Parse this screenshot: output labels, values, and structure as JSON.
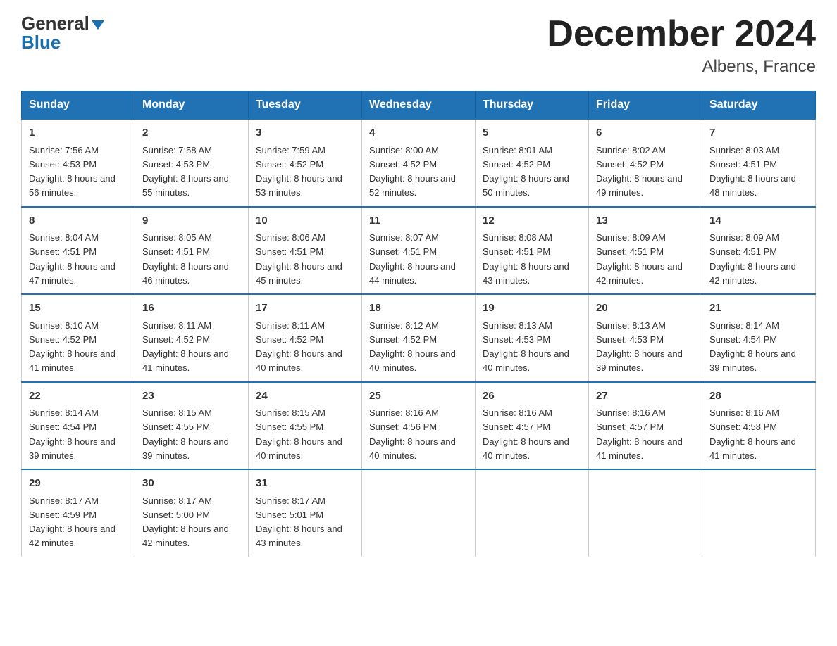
{
  "header": {
    "logo_line1": "General",
    "logo_line2": "Blue",
    "title": "December 2024",
    "subtitle": "Albens, France"
  },
  "days_of_week": [
    "Sunday",
    "Monday",
    "Tuesday",
    "Wednesday",
    "Thursday",
    "Friday",
    "Saturday"
  ],
  "weeks": [
    [
      {
        "day": "1",
        "sunrise": "7:56 AM",
        "sunset": "4:53 PM",
        "daylight": "8 hours and 56 minutes."
      },
      {
        "day": "2",
        "sunrise": "7:58 AM",
        "sunset": "4:53 PM",
        "daylight": "8 hours and 55 minutes."
      },
      {
        "day": "3",
        "sunrise": "7:59 AM",
        "sunset": "4:52 PM",
        "daylight": "8 hours and 53 minutes."
      },
      {
        "day": "4",
        "sunrise": "8:00 AM",
        "sunset": "4:52 PM",
        "daylight": "8 hours and 52 minutes."
      },
      {
        "day": "5",
        "sunrise": "8:01 AM",
        "sunset": "4:52 PM",
        "daylight": "8 hours and 50 minutes."
      },
      {
        "day": "6",
        "sunrise": "8:02 AM",
        "sunset": "4:52 PM",
        "daylight": "8 hours and 49 minutes."
      },
      {
        "day": "7",
        "sunrise": "8:03 AM",
        "sunset": "4:51 PM",
        "daylight": "8 hours and 48 minutes."
      }
    ],
    [
      {
        "day": "8",
        "sunrise": "8:04 AM",
        "sunset": "4:51 PM",
        "daylight": "8 hours and 47 minutes."
      },
      {
        "day": "9",
        "sunrise": "8:05 AM",
        "sunset": "4:51 PM",
        "daylight": "8 hours and 46 minutes."
      },
      {
        "day": "10",
        "sunrise": "8:06 AM",
        "sunset": "4:51 PM",
        "daylight": "8 hours and 45 minutes."
      },
      {
        "day": "11",
        "sunrise": "8:07 AM",
        "sunset": "4:51 PM",
        "daylight": "8 hours and 44 minutes."
      },
      {
        "day": "12",
        "sunrise": "8:08 AM",
        "sunset": "4:51 PM",
        "daylight": "8 hours and 43 minutes."
      },
      {
        "day": "13",
        "sunrise": "8:09 AM",
        "sunset": "4:51 PM",
        "daylight": "8 hours and 42 minutes."
      },
      {
        "day": "14",
        "sunrise": "8:09 AM",
        "sunset": "4:51 PM",
        "daylight": "8 hours and 42 minutes."
      }
    ],
    [
      {
        "day": "15",
        "sunrise": "8:10 AM",
        "sunset": "4:52 PM",
        "daylight": "8 hours and 41 minutes."
      },
      {
        "day": "16",
        "sunrise": "8:11 AM",
        "sunset": "4:52 PM",
        "daylight": "8 hours and 41 minutes."
      },
      {
        "day": "17",
        "sunrise": "8:11 AM",
        "sunset": "4:52 PM",
        "daylight": "8 hours and 40 minutes."
      },
      {
        "day": "18",
        "sunrise": "8:12 AM",
        "sunset": "4:52 PM",
        "daylight": "8 hours and 40 minutes."
      },
      {
        "day": "19",
        "sunrise": "8:13 AM",
        "sunset": "4:53 PM",
        "daylight": "8 hours and 40 minutes."
      },
      {
        "day": "20",
        "sunrise": "8:13 AM",
        "sunset": "4:53 PM",
        "daylight": "8 hours and 39 minutes."
      },
      {
        "day": "21",
        "sunrise": "8:14 AM",
        "sunset": "4:54 PM",
        "daylight": "8 hours and 39 minutes."
      }
    ],
    [
      {
        "day": "22",
        "sunrise": "8:14 AM",
        "sunset": "4:54 PM",
        "daylight": "8 hours and 39 minutes."
      },
      {
        "day": "23",
        "sunrise": "8:15 AM",
        "sunset": "4:55 PM",
        "daylight": "8 hours and 39 minutes."
      },
      {
        "day": "24",
        "sunrise": "8:15 AM",
        "sunset": "4:55 PM",
        "daylight": "8 hours and 40 minutes."
      },
      {
        "day": "25",
        "sunrise": "8:16 AM",
        "sunset": "4:56 PM",
        "daylight": "8 hours and 40 minutes."
      },
      {
        "day": "26",
        "sunrise": "8:16 AM",
        "sunset": "4:57 PM",
        "daylight": "8 hours and 40 minutes."
      },
      {
        "day": "27",
        "sunrise": "8:16 AM",
        "sunset": "4:57 PM",
        "daylight": "8 hours and 41 minutes."
      },
      {
        "day": "28",
        "sunrise": "8:16 AM",
        "sunset": "4:58 PM",
        "daylight": "8 hours and 41 minutes."
      }
    ],
    [
      {
        "day": "29",
        "sunrise": "8:17 AM",
        "sunset": "4:59 PM",
        "daylight": "8 hours and 42 minutes."
      },
      {
        "day": "30",
        "sunrise": "8:17 AM",
        "sunset": "5:00 PM",
        "daylight": "8 hours and 42 minutes."
      },
      {
        "day": "31",
        "sunrise": "8:17 AM",
        "sunset": "5:01 PM",
        "daylight": "8 hours and 43 minutes."
      },
      null,
      null,
      null,
      null
    ]
  ],
  "labels": {
    "sunrise": "Sunrise:",
    "sunset": "Sunset:",
    "daylight": "Daylight:"
  }
}
